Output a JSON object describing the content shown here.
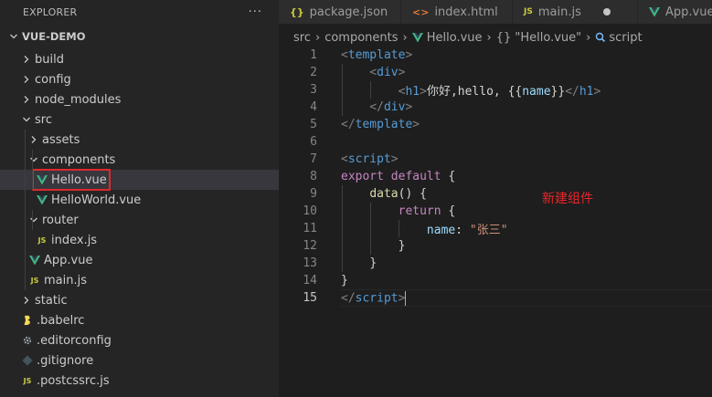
{
  "sidebar": {
    "title": "EXPLORER",
    "more": "···",
    "root": "VUE-DEMO",
    "items": [
      {
        "label": "build",
        "kind": "folder",
        "open": false,
        "depth": 1
      },
      {
        "label": "config",
        "kind": "folder",
        "open": false,
        "depth": 1
      },
      {
        "label": "node_modules",
        "kind": "folder",
        "open": false,
        "depth": 1
      },
      {
        "label": "src",
        "kind": "folder",
        "open": true,
        "depth": 1
      },
      {
        "label": "assets",
        "kind": "folder",
        "open": false,
        "depth": 2
      },
      {
        "label": "components",
        "kind": "folder",
        "open": true,
        "depth": 2
      },
      {
        "label": "Hello.vue",
        "kind": "vue",
        "depth": 3,
        "selected": true,
        "highlighted": true
      },
      {
        "label": "HelloWorld.vue",
        "kind": "vue",
        "depth": 3
      },
      {
        "label": "router",
        "kind": "folder",
        "open": true,
        "depth": 2
      },
      {
        "label": "index.js",
        "kind": "js",
        "depth": 3
      },
      {
        "label": "App.vue",
        "kind": "vue",
        "depth": 2
      },
      {
        "label": "main.js",
        "kind": "js",
        "depth": 2
      },
      {
        "label": "static",
        "kind": "folder",
        "open": false,
        "depth": 1
      },
      {
        "label": ".babelrc",
        "kind": "babel",
        "depth": 1
      },
      {
        "label": ".editorconfig",
        "kind": "gear",
        "depth": 1
      },
      {
        "label": ".gitignore",
        "kind": "git",
        "depth": 1
      },
      {
        "label": ".postcssrc.js",
        "kind": "js",
        "depth": 1
      }
    ]
  },
  "tabs": [
    {
      "label": "package.json",
      "icon": "{}",
      "icon_color": "#cbcb41"
    },
    {
      "label": "index.html",
      "icon": "<>",
      "icon_color": "#e37933"
    },
    {
      "label": "main.js",
      "icon": "JS",
      "icon_color": "#cbcb41",
      "modified": true
    },
    {
      "label": "App.vue",
      "icon": "vue",
      "icon_color": "#41b883"
    }
  ],
  "breadcrumb": {
    "parts": [
      "src",
      "components",
      "Hello.vue",
      "{} \"Hello.vue\"",
      "script"
    ]
  },
  "editor": {
    "lines": [
      "1",
      "2",
      "3",
      "4",
      "5",
      "6",
      "7",
      "8",
      "9",
      "10",
      "11",
      "12",
      "13",
      "14",
      "15"
    ],
    "current_line": "15",
    "code": {
      "l1_tag": "template",
      "l2_tag": "div",
      "l3_tag": "h1",
      "l3_text": "你好,hello, ",
      "l3_open": "{{",
      "l3_var": "name",
      "l3_close": "}}",
      "l4_tag": "div",
      "l5_tag": "template",
      "l7_tag": "script",
      "l8_kw": "export default",
      "l8_rest": " {",
      "l9_fn": "data",
      "l9_rest": "() {",
      "l10_kw": "return",
      "l10_rest": " {",
      "l11_prop": "name",
      "l11_colon": ": ",
      "l11_str": "\"张三\"",
      "l12": "}",
      "l13": "}",
      "l14": "}",
      "l15_tag": "script"
    },
    "annotation": "新建组件",
    "annotation_color": "#e8262a"
  }
}
